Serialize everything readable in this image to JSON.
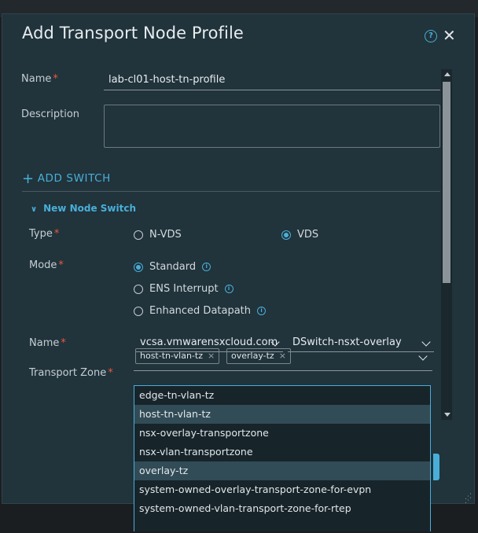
{
  "modal": {
    "title": "Add Transport Node Profile",
    "help_icon": "?",
    "close_icon": "✕"
  },
  "form": {
    "name_label": "Name",
    "required_mark": "*",
    "name_value": "lab-cl01-host-tn-profile",
    "description_label": "Description",
    "description_value": ""
  },
  "add_switch": {
    "icon": "+",
    "label": "ADD SWITCH"
  },
  "node_switch": {
    "header": "New Node Switch",
    "type_label": "Type",
    "type_options": [
      {
        "label": "N-VDS",
        "selected": false
      },
      {
        "label": "VDS",
        "selected": true
      }
    ],
    "mode_label": "Mode",
    "mode_options": [
      {
        "label": "Standard",
        "selected": true
      },
      {
        "label": "ENS Interrupt",
        "selected": false
      },
      {
        "label": "Enhanced Datapath",
        "selected": false
      }
    ],
    "name_label": "Name",
    "vcenter_value": "vcsa.vmwarensxcloud.com",
    "vds_value": "DSwitch-nsxt-overlay",
    "tz_label": "Transport Zone",
    "tz_chips": [
      "host-tn-vlan-tz",
      "overlay-tz"
    ],
    "chip_remove": "×"
  },
  "tz_dropdown": {
    "items": [
      {
        "label": "edge-tn-vlan-tz",
        "selected": false
      },
      {
        "label": "host-tn-vlan-tz",
        "selected": true
      },
      {
        "label": "nsx-overlay-transportzone",
        "selected": false
      },
      {
        "label": "nsx-vlan-transportzone",
        "selected": false
      },
      {
        "label": "overlay-tz",
        "selected": true
      },
      {
        "label": "system-owned-overlay-transport-zone-for-evpn",
        "selected": false
      },
      {
        "label": "system-owned-vlan-transport-zone-for-rtep",
        "selected": false
      }
    ]
  },
  "colors": {
    "modal_bg": "#21333b",
    "accent": "#49afd9",
    "required": "#e9593f",
    "selected_row": "#324c57"
  }
}
